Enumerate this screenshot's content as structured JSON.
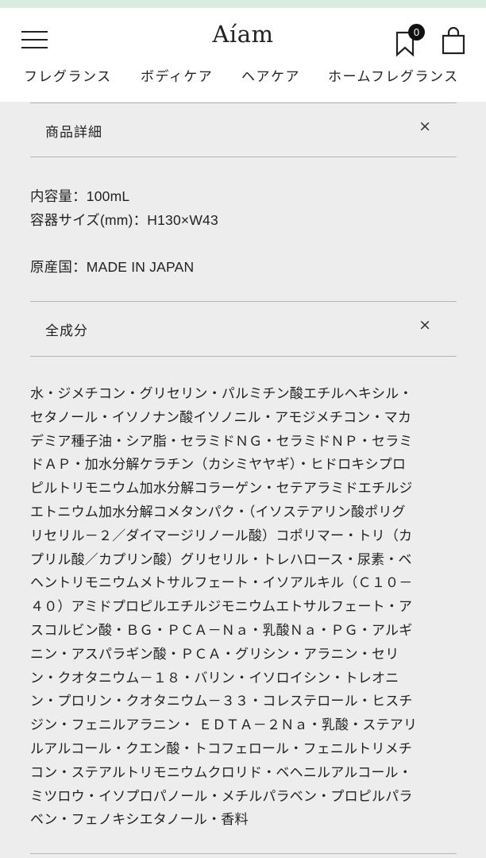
{
  "header": {
    "logo": "Aíam",
    "wishlist_count": "0",
    "nav": [
      {
        "label": "フレグランス"
      },
      {
        "label": "ボディケア"
      },
      {
        "label": "ヘアケア"
      },
      {
        "label": "ホームフレグランス"
      }
    ]
  },
  "icons": {
    "menu": "hamburger-menu-icon",
    "wishlist": "bookmark-icon",
    "cart": "shopping-bag-icon",
    "close": "close-icon"
  },
  "details": {
    "title": "商品詳細",
    "close": "×",
    "capacity": "内容量：100mL",
    "container_size": "容器サイズ(mm)：H130×W43",
    "origin": "原産国：MADE IN JAPAN"
  },
  "ingredients": {
    "title": "全成分",
    "close": "×",
    "lines": [
      "水・ジメチコン・グリセリン・パルミチン酸エチルヘキシル・",
      "セタノール・イソノナン酸イソノニル・アモジメチコン・マカ",
      "デミア種子油・シア脂・セラミドＮＧ・セラミドＮＰ・セラミ",
      "ドＡＰ・加水分解ケラチン（カシミヤヤギ）・ヒドロキシプロ",
      "ピルトリモニウム加水分解コラーゲン・セテアラミドエチルジ",
      "エトニウム加水分解コメタンパク・（イソステアリン酸ポリグ",
      "リセリル－２／ダイマージリノール酸）コポリマー・トリ（カ",
      "プリル酸／カプリン酸）グリセリル・トレハロース・尿素・ベ",
      "ヘントリモニウムメトサルフェート・イソアルキル（Ｃ１０－",
      "４０）アミドプロピルエチルジモニウムエトサルフェート・ア",
      "スコルビン酸・ＢＧ・ＰＣＡ－Ｎａ・乳酸Ｎａ・ＰＧ・アルギ",
      "ニン・アスパラギン酸・ＰＣＡ・グリシン・アラニン・セリ",
      "ン・クオタニウム－１８・バリン・イソロイシン・トレオニ",
      "ン・プロリン・クオタニウム－３３・コレステロール・ヒスチ",
      "ジン・フェニルアラニン・ ＥＤＴＡ－２Ｎａ・乳酸・ステアリ",
      "ルアルコール・クエン酸・トコフェロール・フェニルトリメチ",
      "コン・ステアルトリモニウムクロリド・ベヘニルアルコール・",
      "ミツロウ・イソプロパノール・メチルパラベン・プロピルパラ",
      "ベン・フェノキシエタノール・香料"
    ]
  },
  "colors": {
    "top_strip": "#d9ecdf",
    "header_bg": "#ffffff",
    "page_bg": "#ededed",
    "text": "#222222",
    "divider": "#b5b5b5"
  }
}
